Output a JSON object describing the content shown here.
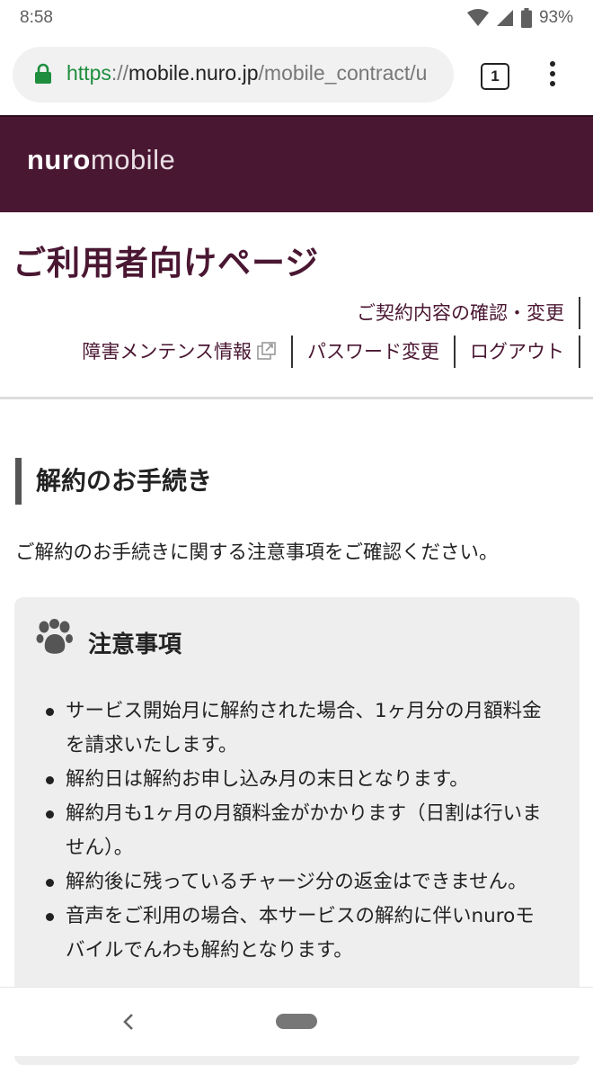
{
  "status_bar": {
    "time": "8:58",
    "battery_percent": "93%"
  },
  "browser": {
    "url_scheme": "https",
    "url_separator": "://",
    "url_host": "mobile.nuro.jp",
    "url_path": "/mobile_contract/u",
    "tab_count": "1",
    "icons": {
      "lock": "lock-icon",
      "menu": "more-vert-icon"
    }
  },
  "header": {
    "logo_bold": "nuro",
    "logo_light": "mobile",
    "background_color": "#4a1732"
  },
  "page_title": "ご利用者向けページ",
  "nav": {
    "contract_link": "ご契約内容の確認・変更",
    "maintenance_link": "障害メンテンス情報",
    "password_link": "パスワード変更",
    "logout_link": "ログアウト"
  },
  "section": {
    "heading": "解約のお手続き",
    "intro": "ご解約のお手続きに関する注意事項をご確認ください。"
  },
  "notice": {
    "title": "注意事項",
    "icon": "paw-icon",
    "items": [
      "サービス開始月に解約された場合、1ヶ月分の月額料金を請求いたします。",
      "解約日は解約お申し込み月の末日となります。",
      "解約月も1ヶ月の月額料金がかかります（日割は行いません）。",
      "解約後に残っているチャージ分の返金はできません。",
      "音声をご利用の場合、本サービスの解約に伴いnuroモバイルでんわも解約となります。"
    ]
  },
  "accent_color": "#4a1732"
}
